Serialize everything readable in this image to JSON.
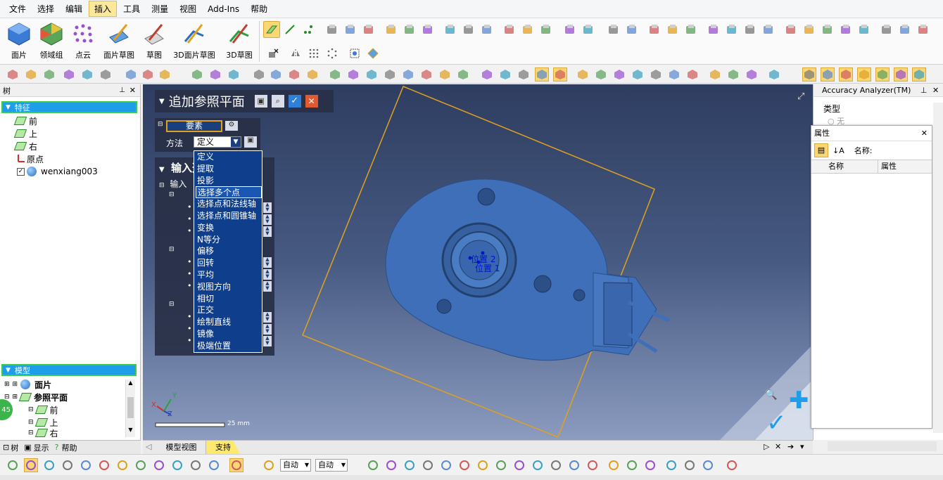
{
  "menu": [
    "文件",
    "选择",
    "编辑",
    "插入",
    "工具",
    "测量",
    "视图",
    "Add-Ins",
    "帮助"
  ],
  "menu_active_index": 3,
  "ribbon": {
    "big_buttons": [
      "面片",
      "领域组",
      "点云",
      "面片草图",
      "草图",
      "3D面片草图",
      "3D草图"
    ]
  },
  "left_panel": {
    "title": "树",
    "features_header": "特征",
    "feature_items": [
      "前",
      "上",
      "右",
      "原点",
      "wenxiang003"
    ],
    "model_header": "模型",
    "model_items": [
      "面片",
      "参照平面",
      "前",
      "上",
      "右"
    ],
    "tabs": [
      "树",
      "显示",
      "帮助"
    ],
    "badge": "45"
  },
  "viewport": {
    "panel_title": "追加参照平面",
    "section_elements": "要素",
    "method_label": "方法",
    "method_value": "定义",
    "input_section": "输入选",
    "input_label": "输入",
    "xyz": [
      "X",
      "Y",
      "Z"
    ],
    "dropdown_options": [
      "定义",
      "提取",
      "投影",
      "选择多个点",
      "选择点和法线轴",
      "选择点和圆锥轴",
      "变换",
      "N等分",
      "偏移",
      "回转",
      "平均",
      "视图方向",
      "相切",
      "正交",
      "绘制直线",
      "镜像",
      "极端位置"
    ],
    "dropdown_selected_index": 3,
    "point_labels": [
      "位置 2",
      "位置 1"
    ],
    "scale_text": "25 mm",
    "axis_labels": {
      "x": "X",
      "y": "Y",
      "z": "Z"
    }
  },
  "right_panel": {
    "title": "Accuracy Analyzer(TM)",
    "type_label": "类型",
    "type_option": "无",
    "props_title": "属性",
    "name_label": "名称:",
    "col_name": "名称",
    "col_prop": "属性"
  },
  "viewport_tabs": [
    "模型视图",
    "支持"
  ],
  "bottom_toolbar": {
    "combo1": "自动",
    "combo2": "自动"
  },
  "colors": {
    "accent": "#fce89a",
    "tree_header": "#1e9ee8",
    "model": "#3f6fb8",
    "plane": "#e0a020"
  }
}
